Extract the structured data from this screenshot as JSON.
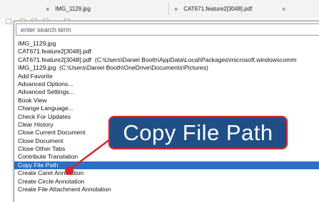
{
  "tabs": [
    {
      "label": "IMG_1129.jpg",
      "close": "×"
    },
    {
      "label": "CAT671.feature2[3048].pdf",
      "close": "×"
    }
  ],
  "search": {
    "placeholder": "enter search term",
    "value": ""
  },
  "items": [
    {
      "label": "IMG_1129.jpg",
      "path": ""
    },
    {
      "label": "CAT671.feature2[3048].pdf",
      "path": ""
    },
    {
      "label": "CAT671.feature2[3048].pdf",
      "path": "(C:\\Users\\Daniel Booth\\AppData\\Local\\Packages\\microsoft.windowscomm"
    },
    {
      "label": "IMG_1129.jpg",
      "path": "(C:\\Users\\Daniel Booth\\OneDrive\\Documents\\Pictures)"
    },
    {
      "label": "Add Favorite",
      "path": ""
    },
    {
      "label": "Advanced Options...",
      "path": ""
    },
    {
      "label": "Advanced Settings...",
      "path": ""
    },
    {
      "label": "Book View",
      "path": ""
    },
    {
      "label": "Change Language...",
      "path": ""
    },
    {
      "label": "Check For Updates",
      "path": ""
    },
    {
      "label": "Clear History",
      "path": ""
    },
    {
      "label": "Close Current Document",
      "path": ""
    },
    {
      "label": "Close Document",
      "path": ""
    },
    {
      "label": "Close Other Tabs",
      "path": ""
    },
    {
      "label": "Contribute Translation",
      "path": ""
    },
    {
      "label": "Copy File Path",
      "path": ""
    },
    {
      "label": "Create Caret Annotation",
      "path": ""
    },
    {
      "label": "Create Circle Annotation",
      "path": ""
    },
    {
      "label": "Create File Attachment Annotation",
      "path": ""
    }
  ],
  "selected_index": 15,
  "callout": {
    "text": "Copy File Path"
  },
  "colors": {
    "selection": "#2b6fc7",
    "callout_bg": "#1f4f86",
    "callout_border": "#d9232e",
    "arrow": "#d9232e"
  }
}
